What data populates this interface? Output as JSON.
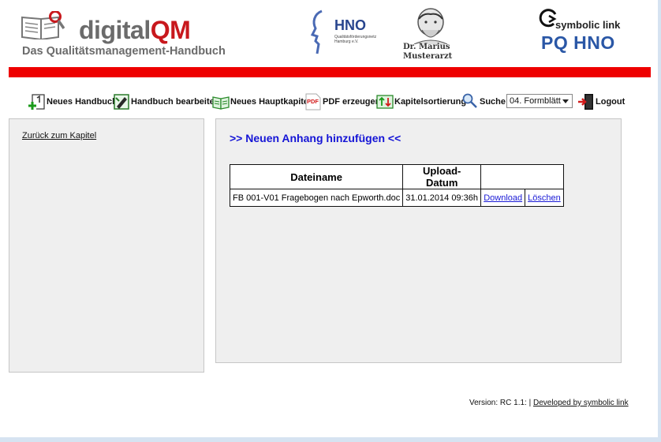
{
  "header": {
    "brand_prefix": "digital",
    "brand_suffix": "QM",
    "brand_subtitle": "Das Qualitätsmanagement-Handbuch",
    "hno_logo_title": "HNO",
    "hno_logo_subtitle": "Qualitätsförderungsnetz Hamburg e.V.",
    "doctor_logo_line1": "Dr. Marius",
    "doctor_logo_line2": "Musterarzt",
    "symbolic_link_title": "symbolic link",
    "symbolic_link_product": "PQ HNO",
    "accent_color": "#ee0000"
  },
  "toolbar": {
    "items": [
      {
        "label": "Neues Handbuch",
        "icon": "new-manual-icon"
      },
      {
        "label": "Handbuch bearbeiten",
        "icon": "edit-manual-icon"
      },
      {
        "label": "Neues Hauptkapitel",
        "icon": "new-chapter-icon"
      },
      {
        "label": "PDF erzeugen",
        "icon": "pdf-icon"
      },
      {
        "label": "Kapitelsortierung",
        "icon": "chapter-sort-icon"
      },
      {
        "label": "Suche",
        "icon": "search-icon"
      },
      {
        "label": "Logout",
        "icon": "logout-icon"
      }
    ],
    "pdf_icon_text": "PDF",
    "select_value": "04. Formblätt"
  },
  "sidebar": {
    "back_link": "Zurück zum Kapitel"
  },
  "main": {
    "heading": ">> Neuen Anhang hinzufügen <<",
    "table": {
      "columns": [
        "Dateiname",
        "Upload-Datum",
        ""
      ],
      "rows": [
        {
          "filename": "FB 001-V01 Fragebogen nach Epworth.doc",
          "date": "31.01.2014 09:36h",
          "download": "Download",
          "delete": "Löschen"
        }
      ]
    }
  },
  "footer": {
    "version": "Version: RC 1.1: |",
    "developer_link": "Developed by symbolic link"
  }
}
